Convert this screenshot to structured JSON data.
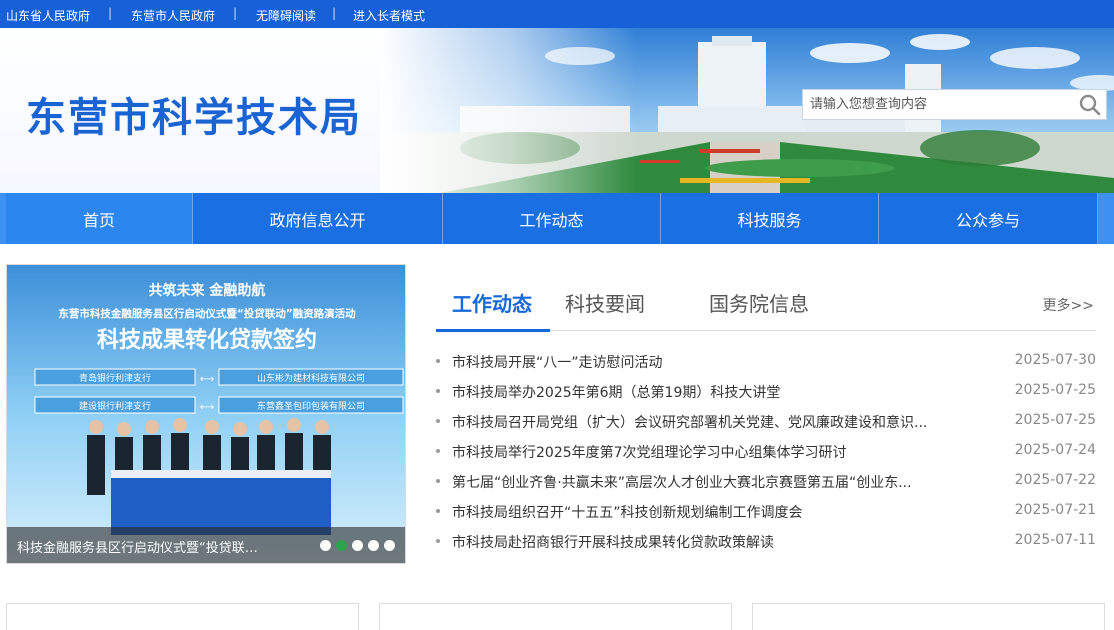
{
  "topbar": {
    "links": [
      "山东省人民政府",
      "东营市人民政府",
      "无障碍阅读",
      "进入长者模式"
    ],
    "separator": "|"
  },
  "header": {
    "site_title": "东营市科学技术局",
    "search_placeholder": "请输入您想查询内容",
    "search_icon": "search-icon"
  },
  "nav": {
    "items": [
      "首页",
      "政府信息公开",
      "工作动态",
      "科技服务",
      "公众参与"
    ],
    "active_index": 0
  },
  "slide": {
    "image_texts": {
      "slogan": "共筑未来 金融助航",
      "event": "东营市科技金融服务县区行启动仪式暨“投贷联动”融资路演活动",
      "headline": "科技成果转化贷款签约",
      "left_signers": [
        "青岛银行利津支行",
        "建设银行利津支行"
      ],
      "right_signers": [
        "山东彬为建材科技有限公司",
        "东营鑫圣包印包装有限公司"
      ]
    },
    "caption": "科技金融服务县区行启动仪式暨“投贷联…",
    "dot_count": 5,
    "active_dot": 1
  },
  "news": {
    "tabs": [
      "工作动态",
      "科技要闻",
      "国务院信息"
    ],
    "active_tab": 0,
    "more_label": "更多>>",
    "items": [
      {
        "title": "市科技局开展“八一”走访慰问活动",
        "date": "2025-07-30"
      },
      {
        "title": "市科技局举办2025年第6期（总第19期）科技大讲堂",
        "date": "2025-07-25"
      },
      {
        "title": "市科技局召开局党组（扩大）会议研究部署机关党建、党风廉政建设和意识...",
        "date": "2025-07-25"
      },
      {
        "title": "市科技局举行2025年度第7次党组理论学习中心组集体学习研讨",
        "date": "2025-07-24"
      },
      {
        "title": "第七届“创业齐鲁·共赢未来”高层次人才创业大赛北京赛暨第五届“创业东...",
        "date": "2025-07-22"
      },
      {
        "title": "市科技局组织召开“十五五”科技创新规划编制工作调度会",
        "date": "2025-07-21"
      },
      {
        "title": "市科技局赴招商银行开展科技成果转化贷款政策解读",
        "date": "2025-07-11"
      }
    ]
  },
  "colors": {
    "brand_blue": "#1661d8",
    "nav_blue": "#1a6fe2",
    "active_dot": "#2aa34a"
  }
}
